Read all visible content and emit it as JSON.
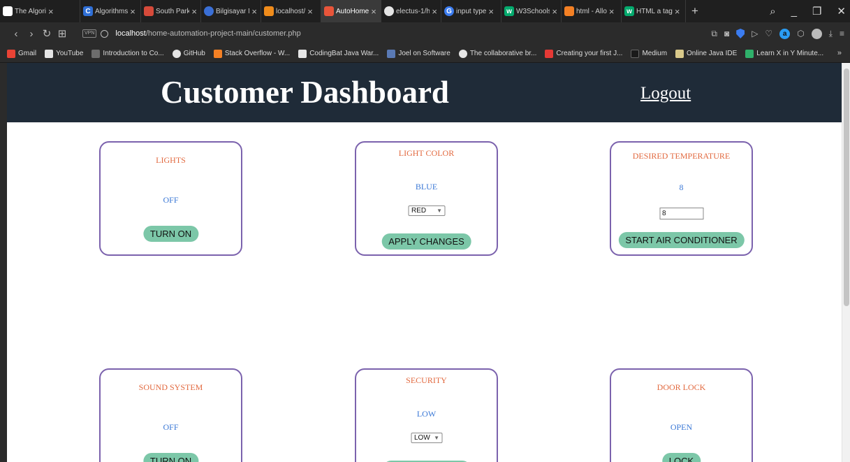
{
  "browser": {
    "tabs": [
      {
        "title": "The Algori",
        "icon_bg": "#ffffff",
        "icon_char": ""
      },
      {
        "title": "Algorithms",
        "icon_bg": "#2f6fd6",
        "icon_char": "C"
      },
      {
        "title": "South Park",
        "icon_bg": "#d64a3a",
        "icon_char": ""
      },
      {
        "title": "Bilgisayar M",
        "icon_bg": "#3a6fd6",
        "icon_char": ""
      },
      {
        "title": "localhost/",
        "icon_bg": "#f08c1b",
        "icon_char": ""
      },
      {
        "title": "AutoHome",
        "icon_bg": "#e8553a",
        "icon_char": "",
        "active": true
      },
      {
        "title": "electus-1/h",
        "icon_bg": "#e5e5e5",
        "icon_char": ""
      },
      {
        "title": "input type",
        "icon_bg": "#3b7cf0",
        "icon_char": "G"
      },
      {
        "title": "W3Schools",
        "icon_bg": "#04aa6d",
        "icon_char": "w"
      },
      {
        "title": "html - Allo",
        "icon_bg": "#f48024",
        "icon_char": ""
      },
      {
        "title": "HTML a tag",
        "icon_bg": "#04aa6d",
        "icon_char": "w"
      }
    ],
    "url_host": "localhost",
    "url_path": "/home-automation-project-main/customer.php",
    "bookmarks": [
      {
        "label": "Gmail",
        "icon_bg": "#ea4335"
      },
      {
        "label": "YouTube",
        "icon_bg": "#e5e5e5"
      },
      {
        "label": "Introduction to Co...",
        "icon_bg": "#6d6d6d"
      },
      {
        "label": "GitHub",
        "icon_bg": "#e5e5e5"
      },
      {
        "label": "Stack Overflow - W...",
        "icon_bg": "#f48024"
      },
      {
        "label": "CodingBat Java War...",
        "icon_bg": "#e5e5e5"
      },
      {
        "label": "Joel on Software",
        "icon_bg": "#5a7ab5"
      },
      {
        "label": "The collaborative br...",
        "icon_bg": "#e5e5e5"
      },
      {
        "label": "Creating your first J...",
        "icon_bg": "#e53935"
      },
      {
        "label": "Medium",
        "icon_bg": "#1a1a1a"
      },
      {
        "label": "Online Java IDE",
        "icon_bg": "#d9c98a"
      },
      {
        "label": "Learn X in Y Minute...",
        "icon_bg": "#2fb06a"
      }
    ]
  },
  "page": {
    "title": "Customer Dashboard",
    "logout": "Logout"
  },
  "cards": {
    "lights": {
      "title": "LIGHTS",
      "status": "OFF",
      "button": "TURN ON"
    },
    "light_color": {
      "title": "LIGHT COLOR",
      "status": "BLUE",
      "select_value": "RED",
      "button": "APPLY CHANGES"
    },
    "temperature": {
      "title": "DESIRED TEMPERATURE",
      "status": "8",
      "input_value": "8",
      "button": "START AIR CONDITIONER"
    },
    "sound": {
      "title": "SOUND SYSTEM",
      "status": "OFF",
      "button": "TURN ON"
    },
    "security": {
      "title": "SECURITY",
      "status": "LOW",
      "select_value": "LOW"
    },
    "door_lock": {
      "title": "DOOR LOCK",
      "status": "OPEN",
      "button": "LOCK"
    }
  },
  "colors": {
    "header_bg": "#1f2b38",
    "card_border": "#7b62ad",
    "card_title": "#e2693f",
    "card_status": "#3b78d6",
    "button_bg": "#7cc7a8"
  }
}
